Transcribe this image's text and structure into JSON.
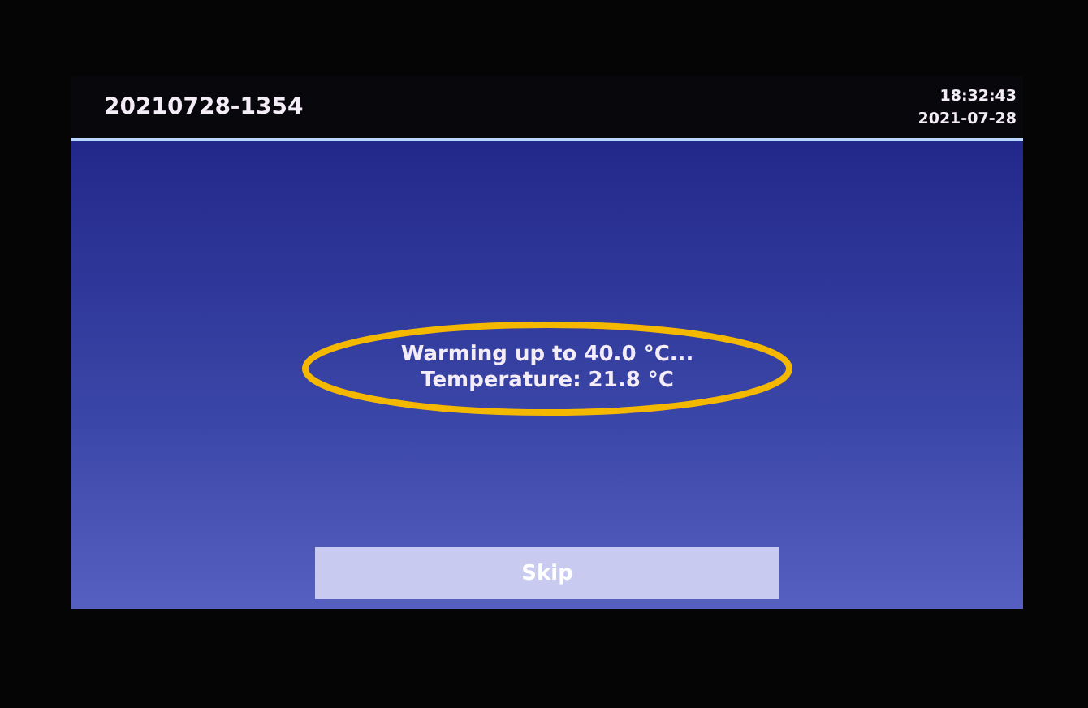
{
  "header": {
    "title": "20210728-1354",
    "time": "18:32:43",
    "date": "2021-07-28"
  },
  "message": {
    "lines": [
      "Warming up to 40.0 °C...",
      "Temperature: 21.8 °C"
    ],
    "highlighted": true
  },
  "buttons": [
    {
      "label": "Skip",
      "kind": "skip"
    }
  ]
}
